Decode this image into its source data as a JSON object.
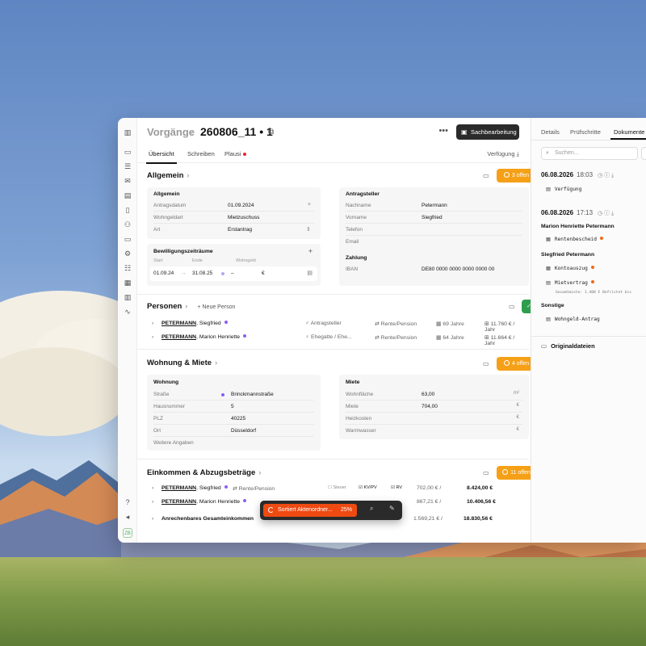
{
  "colors": {
    "accent_orange": "#f5a017",
    "accent_green": "#2e9e4d",
    "progress_red": "#ee4a12",
    "dot_purple": "#8c5cf5",
    "dot_orange": "#f06a1a"
  },
  "header": {
    "breadcrumb": "Vorgänge",
    "case_id": "260806_11 • 1",
    "action_button": "Sachbearbeitung"
  },
  "tabs": {
    "overview": "Übersicht",
    "write": "Schreiben",
    "plausi": "Plausi",
    "verfuegung": "Verfügung"
  },
  "allgemein": {
    "title": "Allgemein",
    "badge": "3 offen",
    "card_general": {
      "title": "Allgemein",
      "rows": [
        {
          "key": "Antragsdatum",
          "value": "01.09.2024"
        },
        {
          "key": "Wohngeldart",
          "value": "Mietzuschuss"
        },
        {
          "key": "Art",
          "value": "Erstantrag"
        }
      ]
    },
    "card_periods": {
      "title": "Bewilligungszeiträume",
      "col_start": "Start",
      "col_end": "Ende",
      "col_wohngeld": "Wohngeld",
      "start": "01.09.24",
      "end": "31.08.25",
      "wohngeld": "–",
      "currency": "€"
    },
    "card_applicant": {
      "title": "Antragsteller",
      "rows": [
        {
          "key": "Nachname",
          "value": "Petermann"
        },
        {
          "key": "Vorname",
          "value": "Siegfried"
        },
        {
          "key": "Telefon",
          "value": ""
        },
        {
          "key": "Email",
          "value": ""
        }
      ],
      "payment_title": "Zahlung",
      "iban_key": "IBAN",
      "iban_value": "DE80 0000 0000 0000 0000 00"
    }
  },
  "personen": {
    "title": "Personen",
    "add_label": "+ Neue Person",
    "rows": [
      {
        "last": "PETERMANN",
        "first": ", Siegfried",
        "role": "Antragsteller",
        "income": "Rente/Pension",
        "age": "69 Jahre",
        "amount": "11.760 € / Jahr"
      },
      {
        "last": "PETERMANN",
        "first": ", Marion Henriette",
        "role": "Ehegatte / Ehe...",
        "income": "Rente/Pension",
        "age": "64 Jahre",
        "amount": "11.664 € / Jahr"
      }
    ]
  },
  "wohnung": {
    "title": "Wohnung & Miete",
    "badge": "4 offen",
    "card_wohnung": {
      "title": "Wohnung",
      "rows": [
        {
          "key": "Straße",
          "value": "Brinckmannstraße"
        },
        {
          "key": "Hausnummer",
          "value": "5"
        },
        {
          "key": "PLZ",
          "value": "40225"
        },
        {
          "key": "Ort",
          "value": "Düsseldorf"
        },
        {
          "key": "Weitere Angaben",
          "value": ""
        }
      ]
    },
    "card_miete": {
      "title": "Miete",
      "rows": [
        {
          "key": "Wohnfläche",
          "value": "63,00",
          "unit": "m²"
        },
        {
          "key": "Miete",
          "value": "704,00",
          "unit": "€"
        },
        {
          "key": "Heizkosten",
          "value": "",
          "unit": "€"
        },
        {
          "key": "Warmwasser",
          "value": "",
          "unit": "€"
        }
      ]
    }
  },
  "einkommen": {
    "title": "Einkommen & Abzugsbeträge",
    "badge": "11 offen",
    "rows": [
      {
        "last": "PETERMANN",
        "first": ", Siegfried",
        "income": "Rente/Pension",
        "steuer": "Steuer",
        "kvpv": "KV/PV",
        "rv": "RV",
        "monthly": "702,00 € /",
        "total": "8.424,00 €"
      },
      {
        "last": "PETERMANN",
        "first": ", Marion Henriette",
        "income": "",
        "steuer": "",
        "kvpv": "",
        "rv": "",
        "monthly": "867,21 € /",
        "total": "10.406,56 €"
      }
    ],
    "sum_label": "Anrechenbares Gesamteinkommen",
    "sum_monthly": "1.569,21 € /",
    "sum_total": "18.830,56 €"
  },
  "toolbar": {
    "progress_label": "Sortiert Aktenordner...",
    "progress_value": 0.25,
    "progress_pct": "25%"
  },
  "side": {
    "tabs": [
      "Details",
      "Prüfschritte",
      "Dokumente"
    ],
    "search_placeholder": "Suchen...",
    "groups": [
      {
        "date": "06.08.2026",
        "time": "18:03",
        "docs": [
          "Verfügung"
        ]
      },
      {
        "date": "06.08.2026",
        "time": "17:13"
      }
    ],
    "person1": "Marion Henriette Petermann",
    "person1_doc": "Rentenbescheid",
    "person2": "Siegfried Petermann",
    "person2_doc1": "Kontoauszug",
    "person2_doc2": "Mietvertrag",
    "person2_doc2_meta": "Gesamtmiete: 1.408 €   Befristet bis",
    "other": "Sonstige",
    "other_doc": "Wohngeld-Antrag",
    "original_files": "Originaldateien"
  }
}
